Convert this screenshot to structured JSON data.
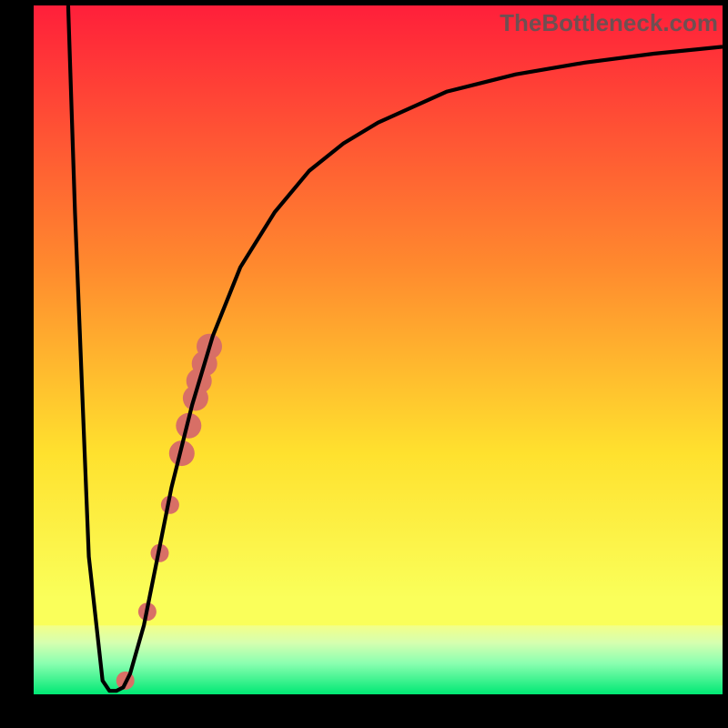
{
  "watermark": "TheBottleneck.com",
  "colors": {
    "gradient_top": "#ff1f3a",
    "gradient_mid1": "#ff8a2e",
    "gradient_mid2": "#ffe12e",
    "gradient_mid3": "#faff5a",
    "gradient_band": "#e8ffb0",
    "gradient_bottom": "#00e874",
    "curve": "#000000",
    "markers": "#d86f66"
  },
  "chart_data": {
    "type": "line",
    "title": "",
    "xlabel": "",
    "ylabel": "",
    "xlim": [
      0,
      100
    ],
    "ylim": [
      0,
      100
    ],
    "series": [
      {
        "name": "curve",
        "x": [
          5,
          6,
          8,
          10,
          11,
          12,
          13,
          14,
          16,
          18,
          20,
          23,
          26,
          30,
          35,
          40,
          45,
          50,
          60,
          70,
          80,
          90,
          100
        ],
        "y": [
          100,
          70,
          20,
          2,
          0.5,
          0.5,
          1,
          3,
          10,
          20,
          30,
          42,
          52,
          62,
          70,
          76,
          80,
          83,
          87.5,
          90,
          91.7,
          93,
          94
        ]
      }
    ],
    "markers": [
      {
        "x": 13.3,
        "y": 2.0,
        "r": 10
      },
      {
        "x": 16.5,
        "y": 12.0,
        "r": 10
      },
      {
        "x": 18.3,
        "y": 20.5,
        "r": 10
      },
      {
        "x": 19.8,
        "y": 27.5,
        "r": 10
      },
      {
        "x": 21.5,
        "y": 35.0,
        "r": 14
      },
      {
        "x": 22.5,
        "y": 39.0,
        "r": 14
      },
      {
        "x": 23.5,
        "y": 43.0,
        "r": 14
      },
      {
        "x": 24.0,
        "y": 45.5,
        "r": 14
      },
      {
        "x": 24.8,
        "y": 48.0,
        "r": 14
      },
      {
        "x": 25.5,
        "y": 50.5,
        "r": 14
      }
    ],
    "green_band_top": 10
  }
}
